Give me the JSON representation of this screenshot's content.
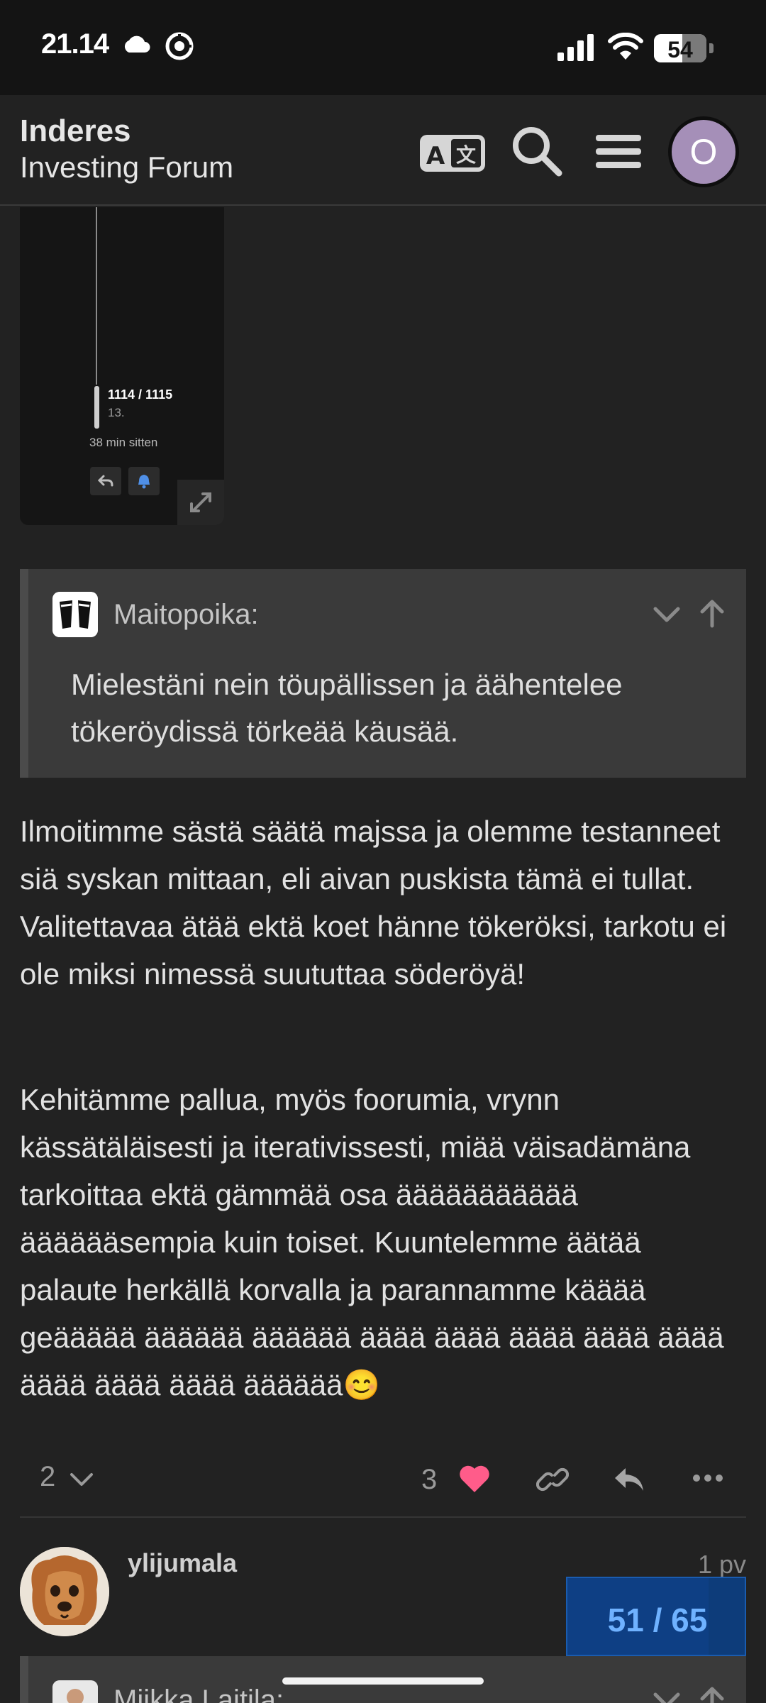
{
  "status_bar": {
    "time": "21.14",
    "battery": "54",
    "battery_level_percent": 54,
    "icons": [
      "cloud-icon",
      "app-notification-icon",
      "signal-icon",
      "wifi-icon",
      "battery-icon"
    ]
  },
  "header": {
    "title": "Inderes",
    "subtitle": "Investing Forum",
    "avatar_letter": "O",
    "avatar_color": "#a58fb8",
    "icons": [
      "translate-icon",
      "search-icon",
      "hamburger-menu-icon"
    ]
  },
  "embed": {
    "post_count": "1114 / 1115",
    "date": "13.",
    "time_ago": "38 min sitten"
  },
  "quote": {
    "author": "Maitopoika:",
    "text": "Mielestäni nein töupällissen ja äähentelee tökeröydissä törkeää käusää."
  },
  "post": {
    "paragraph1": "Ilmoitimme sästä säätä majssa ja olemme testanneet siä syskan mittaan, eli aivan puskista tämä ei tullat. Valitettavaa ätää ektä koet hänne tökeröksi, tarkotu ei ole miksi nimessä suututtaa söderöyä!",
    "paragraph2": "Kehitämme pallua, myös foorumia, vrynn kässätäläisesti ja iterativissesti, miää väisadämäna tarkoittaa ektä gämmää osa äääääääääää ääääääsempia kuin toiset. Kuuntelemme äätää palaute herkällä korvalla ja parannamme kääää geäääää ääääää ääääää ääää ääää ääää ääää ääää ääää ääää ääää ääääää😊"
  },
  "controls": {
    "replies_count": "2",
    "likes_count": "3",
    "like_color": "#ff5c8a"
  },
  "next_post": {
    "username": "ylijumala",
    "age": "1 pv",
    "quote_author": "Miikka Laitila:"
  },
  "progress": {
    "label": "51 / 65",
    "current": 51,
    "total": 65
  }
}
